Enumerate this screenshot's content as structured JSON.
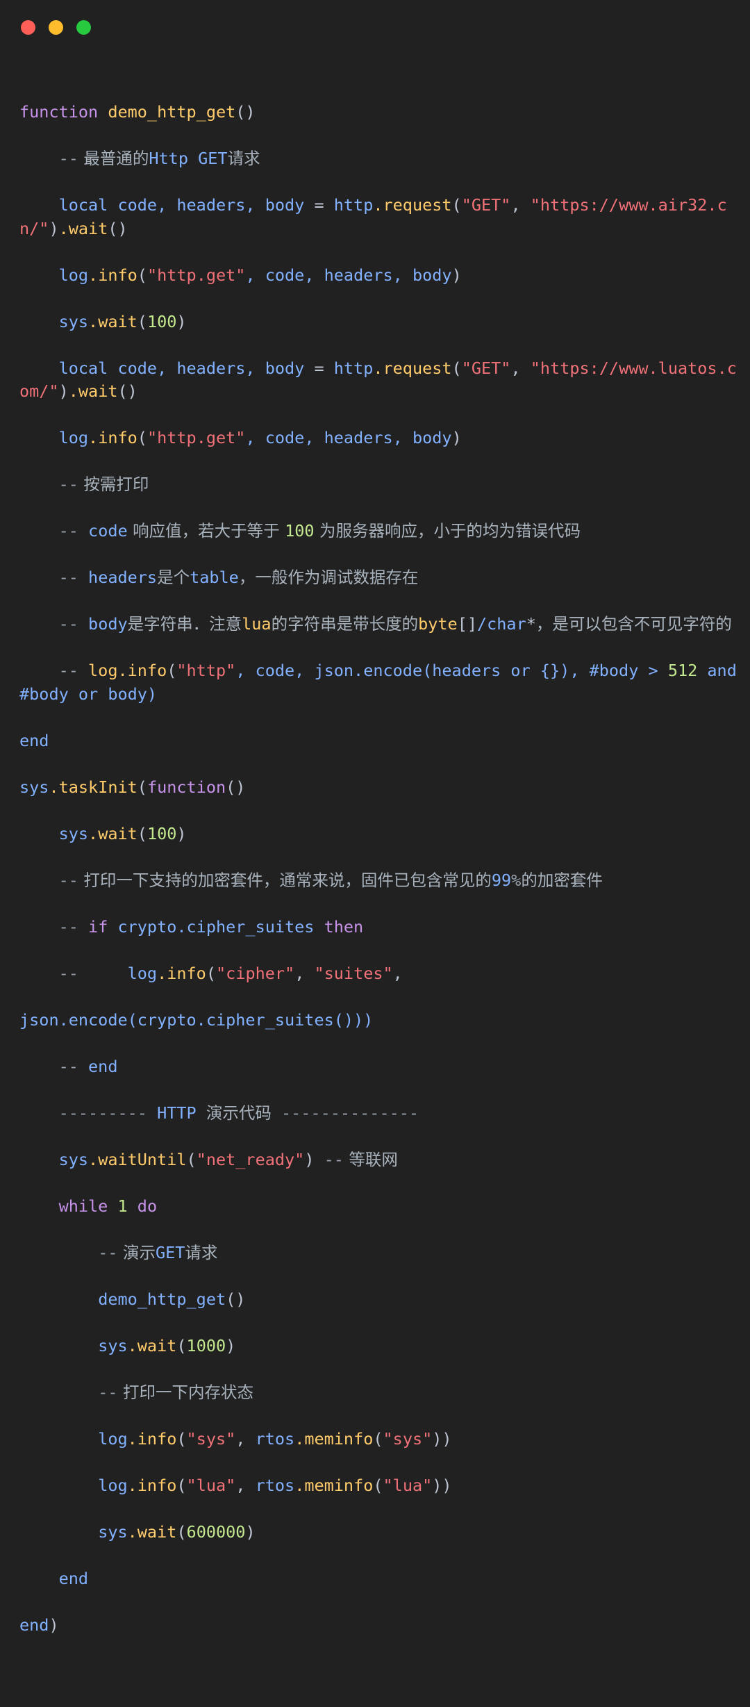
{
  "window": {
    "title": "",
    "controls": [
      {
        "name": "close",
        "color": "#ff5f56"
      },
      {
        "name": "minimize",
        "color": "#ffbd2e"
      },
      {
        "name": "maximize",
        "color": "#27c93f"
      }
    ]
  },
  "editor": {
    "language": "lua",
    "background": "#212121",
    "theme_colors": {
      "keyword": "#c792ea",
      "function": "#ffcb6b",
      "identifier": "#82b1ff",
      "string": "#f07178",
      "number": "#c3e88d",
      "punctuation": "#bfc7d5",
      "comment": "#9aa3ad"
    },
    "code": {
      "l1_function": "function",
      "l1_name": "demo_http_get",
      "l1_parens": "()",
      "l2_dashes": "--",
      "l2_text_a": " 最普通的",
      "l2_http": "Http",
      "l2_space": " ",
      "l2_get": "GET",
      "l2_text_b": "请求",
      "l3_local": "local",
      "l3_vars": " code, headers, body ",
      "l3_eq": "= ",
      "l3_http": "http",
      "l3_dot_request": ".request",
      "l3_open": "(",
      "l3_get_str": "\"GET\"",
      "l3_comma": ", ",
      "l3_url": "\"https://www.air32.cn/\"",
      "l3_close": ")",
      "l3_dot_wait": ".wait",
      "l3_wait_parens": "()",
      "l4_log": "log",
      "l4_info": ".info",
      "l4_open": "(",
      "l4_str": "\"http.get\"",
      "l4_args": ", code, headers, body",
      "l4_close": ")",
      "l5_sys": "sys",
      "l5_wait": ".wait",
      "l5_open": "(",
      "l5_num": "100",
      "l5_close": ")",
      "l6_url": "\"https://www.luatos.com/\"",
      "l8_dashes": "--",
      "l8_text": " 按需打印",
      "l9_code": "code",
      "l9_text_a": " 响应值，若大于等于 ",
      "l9_num": "100",
      "l9_text_b": " 为服务器响应，小于的均为错误代码",
      "l10_headers": "headers",
      "l10_text_a": "是个",
      "l10_table": "table",
      "l10_text_b": "，一般作为调试数据存在",
      "l11_body": "body",
      "l11_text_a": "是字符串．注意",
      "l11_lua": "lua",
      "l11_text_b": "的字符串是带长度的",
      "l11_byte": "byte",
      "l11_brackets": "[]",
      "l11_char": "/char",
      "l11_star": "*",
      "l11_text_c": "，是可以包含不可见字符的",
      "l12_dashes": "--",
      "l12_log": " log",
      "l12_info": ".info",
      "l12_open": "(",
      "l12_str": "\"http\"",
      "l12_mid": ", code, json.encode(headers or {}), #body > ",
      "l12_num": "512",
      "l12_tail": " and #body or body)",
      "l13_end": "end",
      "l14_sys": "sys",
      "l14_taskinit": ".taskInit",
      "l14_open": "(",
      "l14_function": "function",
      "l14_parens": "()",
      "l15_num": "100",
      "l16_dashes": "--",
      "l16_text_a": " 打印一下支持的加密套件，通常来说，固件已包含常见的",
      "l16_num": "99",
      "l16_pct": "%",
      "l16_text_b": "的加密套件",
      "l17_dashes": "--",
      "l17_if": "if",
      "l17_cond": " crypto.cipher_suites ",
      "l17_then": "then",
      "l18_dashes": "--",
      "l18_log": "log",
      "l18_info": ".info",
      "l18_open": "(",
      "l18_str1": "\"cipher\"",
      "l18_comma": ", ",
      "l18_str2": "\"suites\"",
      "l18_tail": ",",
      "l19_code": "json.encode(crypto.cipher_suites()))",
      "l20_dashes": "--",
      "l20_end": " end",
      "l21_dashes_left": "---------",
      "l21_http": " HTTP ",
      "l21_text": "演示代码",
      "l21_dashes_right": " --------------",
      "l22_sys": "sys",
      "l22_waituntil": ".waitUntil",
      "l22_open": "(",
      "l22_str": "\"net_ready\"",
      "l22_close": ")",
      "l22_dashes": " --",
      "l22_text": " 等联网",
      "l23_while": "while",
      "l23_num": " 1 ",
      "l23_do": "do",
      "l24_dashes": "--",
      "l24_text_a": " 演示",
      "l24_get": "GET",
      "l24_text_b": "请求",
      "l25_call": "demo_http_get",
      "l25_parens": "()",
      "l26_sys": "sys",
      "l26_wait": ".wait",
      "l26_open": "(",
      "l26_num": "1000",
      "l26_close": ")",
      "l27_dashes": "--",
      "l27_text": " 打印一下内存状态",
      "l28_log": "log",
      "l28_info": ".info",
      "l28_open": "(",
      "l28_str1": "\"sys\"",
      "l28_comma": ", ",
      "l28_rtos": "rtos",
      "l28_meminfo": ".meminfo",
      "l28_open2": "(",
      "l28_str2": "\"sys\"",
      "l28_close": "))",
      "l29_str1": "\"lua\"",
      "l29_str2": "\"lua\"",
      "l30_sys": "sys",
      "l30_wait": ".wait",
      "l30_open": "(",
      "l30_num": "600000",
      "l30_close": ")",
      "l31_end": "end",
      "l32_end": "end",
      "l32_paren": ")"
    }
  }
}
